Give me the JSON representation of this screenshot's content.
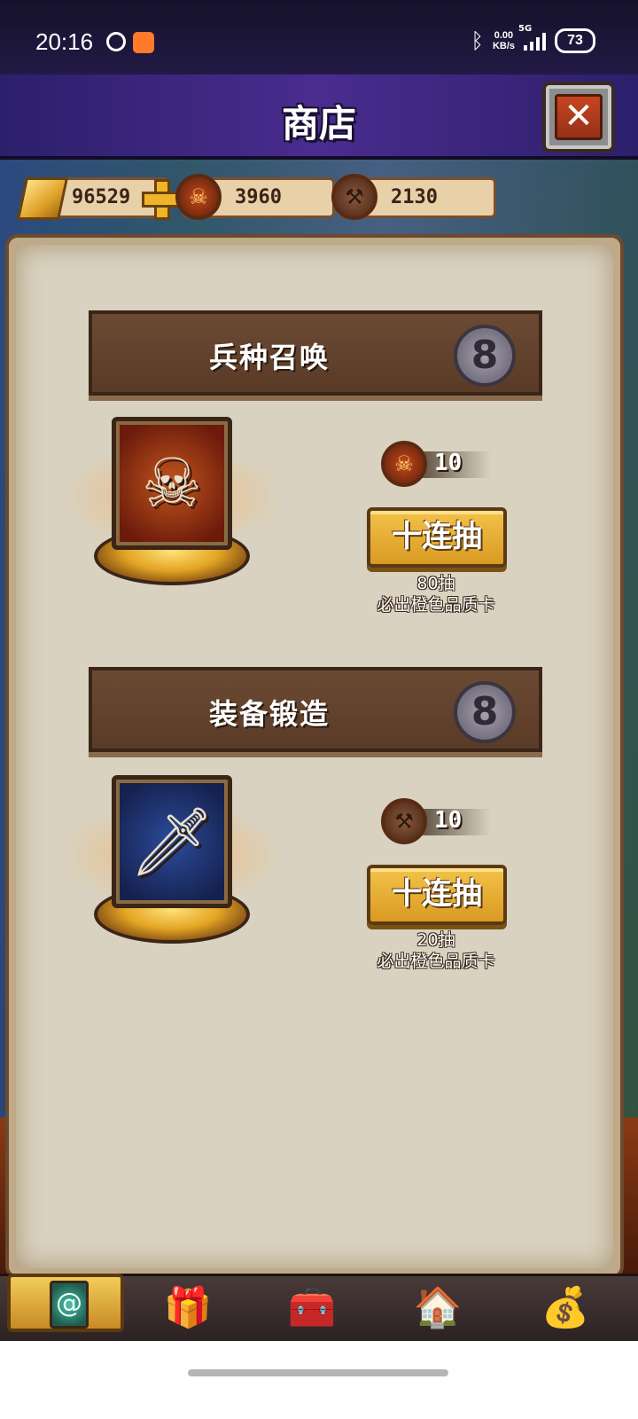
{
  "status_bar": {
    "time": "20:16",
    "net_rate_value": "0.00",
    "net_rate_unit": "KB/s",
    "network_type": "5G",
    "battery": "73",
    "icons": [
      "weibo-icon",
      "video-app-icon",
      "bluetooth-icon",
      "signal-icon",
      "battery-icon"
    ]
  },
  "header": {
    "title": "商店",
    "close_icon": "close-icon"
  },
  "currencies": [
    {
      "name": "gold",
      "icon": "gold-bar-icon",
      "value": "96529"
    },
    {
      "name": "summon-token",
      "icon": "demon-skull-icon",
      "value": "3960"
    },
    {
      "name": "forge-token",
      "icon": "anvil-icon",
      "value": "2130"
    }
  ],
  "sections": [
    {
      "title": "兵种召唤",
      "info_glyph": "8",
      "art_icon": "skeleton-warrior-icon",
      "cost_icon": "demon-skull-icon",
      "cost": "10",
      "button_label": "十连抽",
      "note_line1": "80抽",
      "note_line2": "必出橙色品质卡"
    },
    {
      "title": "装备锻造",
      "info_glyph": "8",
      "art_icon": "sword-icon",
      "cost_icon": "anvil-icon",
      "cost": "10",
      "button_label": "十连抽",
      "note_line1": "20抽",
      "note_line2": "必出橙色品质卡"
    }
  ],
  "bottom_nav": {
    "active_index": 0,
    "items": [
      {
        "icon": "card-deck-icon"
      },
      {
        "icon": "gift-box-icon"
      },
      {
        "icon": "treasure-chest-icon"
      },
      {
        "icon": "viking-house-icon"
      },
      {
        "icon": "money-bag-icon"
      }
    ]
  },
  "colors": {
    "accent_gold": "#d99a22",
    "title_bar": "#4a2c8f",
    "parchment": "#d9d2c0",
    "header_wood": "#5a3b27"
  }
}
